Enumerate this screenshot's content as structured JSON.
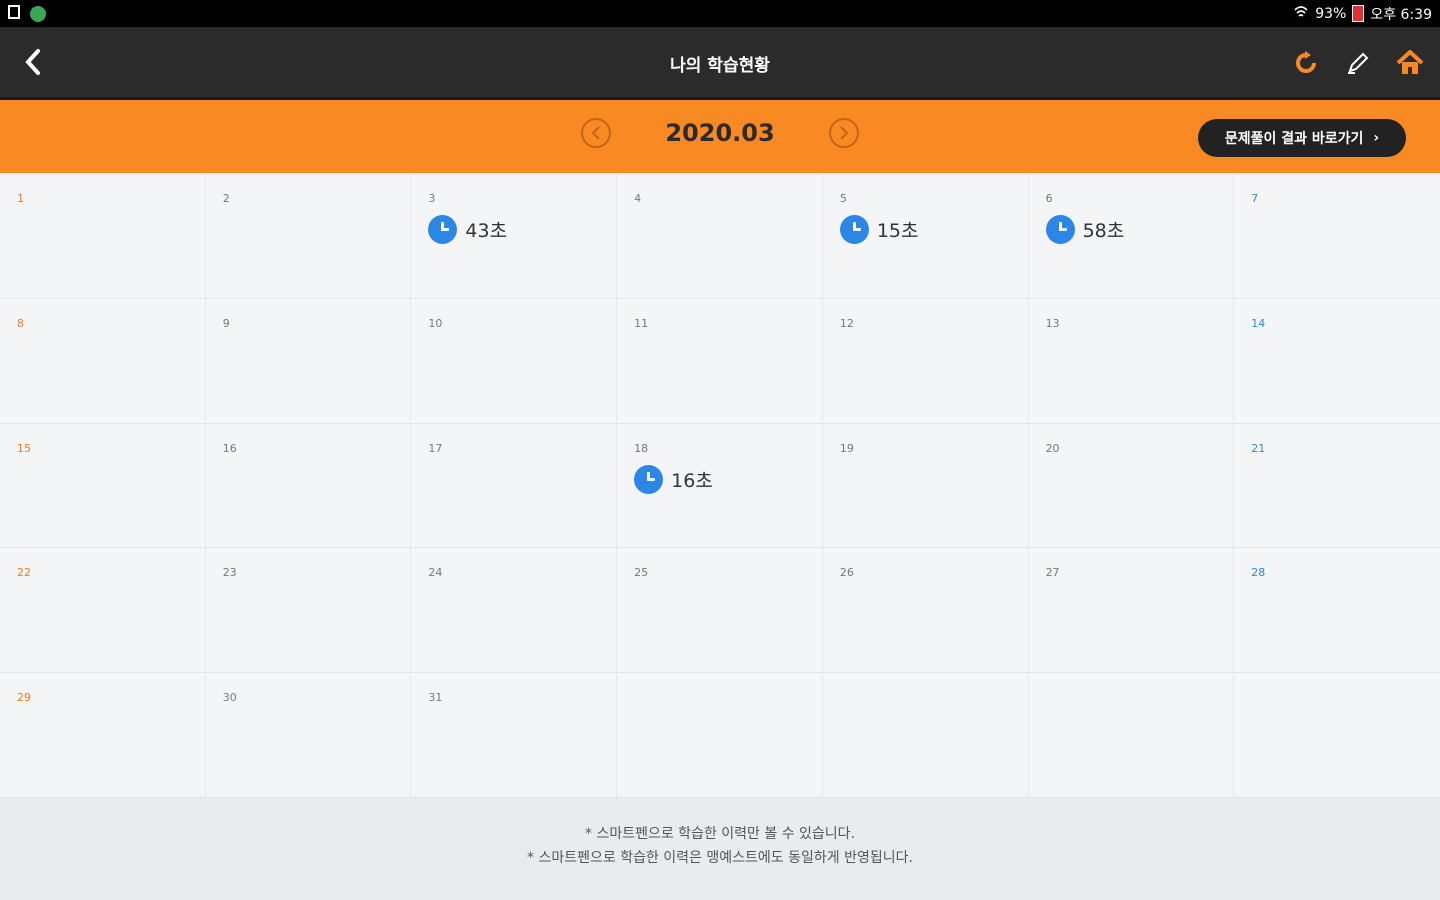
{
  "status_bar": {
    "battery_percent": "93%",
    "time": "오후 6:39"
  },
  "header": {
    "title": "나의 학습현황"
  },
  "month_nav": {
    "month": "2020.03",
    "prev_icon": "chevron-left-icon",
    "next_icon": "chevron-right-icon"
  },
  "result_button": {
    "label": "문제풀이 결과 바로가기",
    "arrow": "›"
  },
  "calendar": {
    "cells": [
      {
        "date": "1",
        "kind": "sun",
        "time": ""
      },
      {
        "date": "2",
        "kind": "",
        "time": ""
      },
      {
        "date": "3",
        "kind": "",
        "time": "43초"
      },
      {
        "date": "4",
        "kind": "",
        "time": ""
      },
      {
        "date": "5",
        "kind": "",
        "time": "15초"
      },
      {
        "date": "6",
        "kind": "",
        "time": "58초"
      },
      {
        "date": "7",
        "kind": "sat",
        "time": ""
      },
      {
        "date": "8",
        "kind": "sun",
        "time": ""
      },
      {
        "date": "9",
        "kind": "",
        "time": ""
      },
      {
        "date": "10",
        "kind": "",
        "time": ""
      },
      {
        "date": "11",
        "kind": "",
        "time": ""
      },
      {
        "date": "12",
        "kind": "",
        "time": ""
      },
      {
        "date": "13",
        "kind": "",
        "time": ""
      },
      {
        "date": "14",
        "kind": "sat",
        "time": ""
      },
      {
        "date": "15",
        "kind": "sun",
        "time": ""
      },
      {
        "date": "16",
        "kind": "",
        "time": ""
      },
      {
        "date": "17",
        "kind": "",
        "time": ""
      },
      {
        "date": "18",
        "kind": "",
        "time": "16초"
      },
      {
        "date": "19",
        "kind": "",
        "time": ""
      },
      {
        "date": "20",
        "kind": "",
        "time": ""
      },
      {
        "date": "21",
        "kind": "sat",
        "time": ""
      },
      {
        "date": "22",
        "kind": "sun",
        "time": ""
      },
      {
        "date": "23",
        "kind": "",
        "time": ""
      },
      {
        "date": "24",
        "kind": "",
        "time": ""
      },
      {
        "date": "25",
        "kind": "",
        "time": ""
      },
      {
        "date": "26",
        "kind": "",
        "time": ""
      },
      {
        "date": "27",
        "kind": "",
        "time": ""
      },
      {
        "date": "28",
        "kind": "sat",
        "time": ""
      },
      {
        "date": "29",
        "kind": "sun",
        "time": ""
      },
      {
        "date": "30",
        "kind": "",
        "time": ""
      },
      {
        "date": "31",
        "kind": "",
        "time": ""
      },
      {
        "date": "",
        "kind": "",
        "time": ""
      },
      {
        "date": "",
        "kind": "",
        "time": ""
      },
      {
        "date": "",
        "kind": "",
        "time": ""
      },
      {
        "date": "",
        "kind": "",
        "time": ""
      }
    ]
  },
  "footer": {
    "note_1": "* 스마트펜으로 학습한 이력만 볼 수 있습니다.",
    "note_2": "* 스마트펜으로 학습한 이력은 맹예스트에도 동일하게 반영됩니다."
  },
  "colors": {
    "accent": "#f98a23",
    "header_bg": "#2b2b2b",
    "clock": "#2b86e6",
    "sunday": "#f07a1e",
    "saturday": "#2a8ad6"
  }
}
